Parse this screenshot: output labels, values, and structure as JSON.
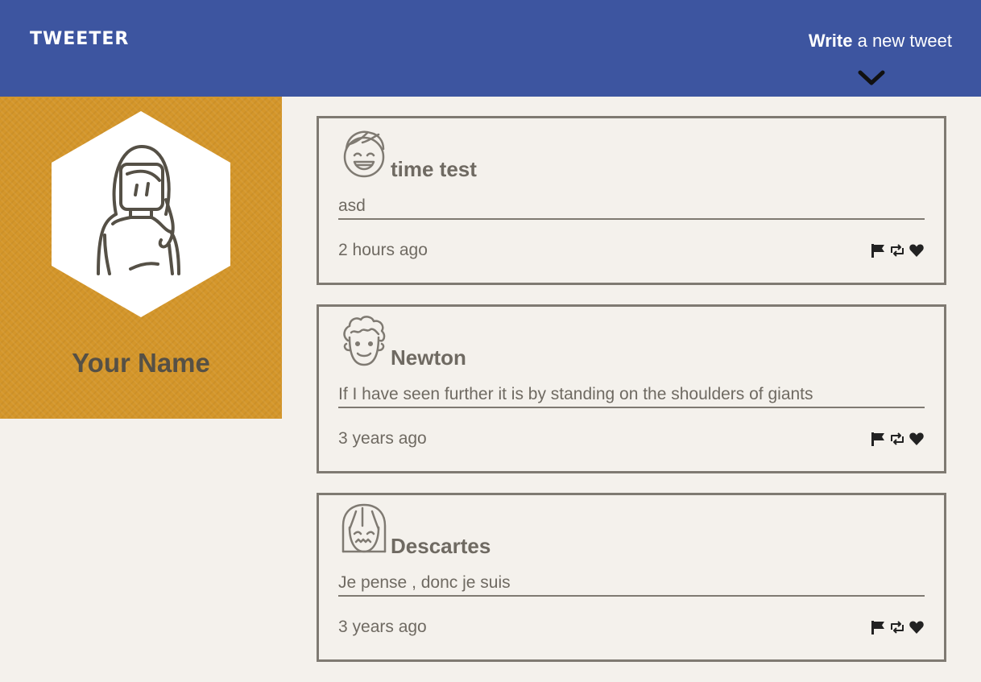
{
  "header": {
    "brand": "TWEETER",
    "compose_bold": "Write",
    "compose_rest": " a new tweet"
  },
  "profile": {
    "name": "Your Name"
  },
  "tweets": [
    {
      "author": "time test",
      "text": "asd",
      "time": "2 hours ago"
    },
    {
      "author": "Newton",
      "text": "If I have seen further it is by standing on the shoulders of giants",
      "time": "3 years ago"
    },
    {
      "author": "Descartes",
      "text": "Je pense , donc je suis",
      "time": "3 years ago"
    }
  ],
  "icons": {
    "compose_toggle": "chevron-down-icon",
    "flag": "flag-icon",
    "retweet": "retweet-icon",
    "like": "heart-icon"
  },
  "colors": {
    "header": "#3d55a0",
    "profile_panel": "#d4962a",
    "background": "#f4f1ec",
    "text": "#6f6a62"
  }
}
